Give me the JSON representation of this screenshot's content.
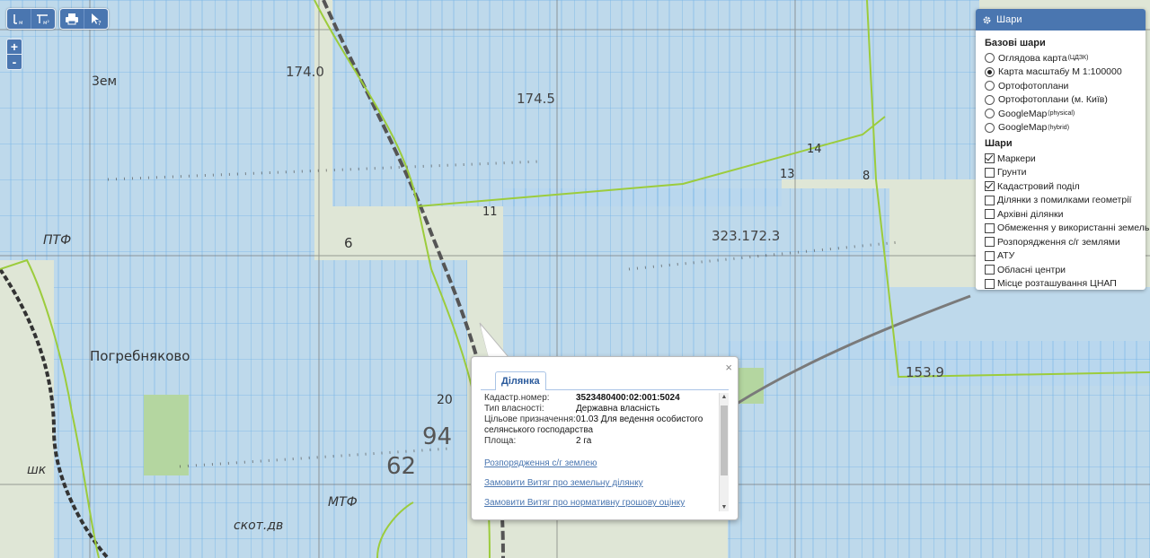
{
  "map": {
    "labels": [
      {
        "text": "174.0",
        "class": "elev"
      },
      {
        "text": "174.5",
        "class": "elev"
      },
      {
        "text": "3ем",
        "class": "place"
      },
      {
        "text": "ПТФ",
        "class": "place"
      },
      {
        "text": "6",
        "class": "elev"
      },
      {
        "text": "Погребняково",
        "class": "place"
      },
      {
        "text": "20",
        "class": "elev"
      },
      {
        "text": "94",
        "class": "big"
      },
      {
        "text": "62",
        "class": "big"
      },
      {
        "text": "МТФ",
        "class": "place"
      },
      {
        "text": "скот.дв",
        "class": "place"
      },
      {
        "text": "шк",
        "class": "place"
      },
      {
        "text": "323.172.3",
        "class": "elev"
      },
      {
        "text": "153.9",
        "class": "elev"
      },
      {
        "text": "13",
        "class": "elev"
      },
      {
        "text": "14",
        "class": "elev"
      },
      {
        "text": "8",
        "class": "elev"
      },
      {
        "text": "11",
        "class": "elev"
      }
    ]
  },
  "toolbar": {
    "buttons": [
      {
        "name": "measure-distance-button",
        "icon": "ruler-icon"
      },
      {
        "name": "measure-area-button",
        "icon": "area-measure-icon"
      },
      {
        "name": "print-button",
        "icon": "printer-icon"
      },
      {
        "name": "identify-button",
        "icon": "cursor-help-icon"
      }
    ]
  },
  "zoom": {
    "in": "+",
    "out": "-"
  },
  "layers": {
    "title": "Шари",
    "base_title": "Базові шари",
    "base": [
      {
        "label": "Оглядова карта",
        "sup": "(ЦДЗК)",
        "selected": false
      },
      {
        "label": "Карта масштабу М 1:100000",
        "sup": "",
        "selected": true
      },
      {
        "label": "Ортофотоплани",
        "sup": "",
        "selected": false
      },
      {
        "label": "Ортофотоплани (м. Київ)",
        "sup": "",
        "selected": false
      },
      {
        "label": "GoogleMap",
        "sup": "(physical)",
        "selected": false
      },
      {
        "label": "GoogleMap",
        "sup": "(hybrid)",
        "selected": false
      }
    ],
    "overlay_title": "Шари",
    "overlays": [
      {
        "label": "Маркери",
        "checked": true
      },
      {
        "label": "Грунти",
        "checked": false
      },
      {
        "label": "Кадастровий поділ",
        "checked": true
      },
      {
        "label": "Ділянки з помилками геометрії",
        "checked": false
      },
      {
        "label": "Архівні ділянки",
        "checked": false
      },
      {
        "label": "Обмеження у використанні земель",
        "checked": false
      },
      {
        "label": "Розпорядження с/г землями",
        "checked": false
      },
      {
        "label": "АТУ",
        "checked": false
      },
      {
        "label": "Обласні центри",
        "checked": false
      },
      {
        "label": "Місце розташування ЦНАП",
        "checked": false
      }
    ]
  },
  "popup": {
    "tab": "Ділянка",
    "close": "×",
    "rows": [
      {
        "k": "Кадастр.номер:",
        "v": "3523480400:02:001:5024",
        "bold": true
      },
      {
        "k": "Тип власності:",
        "v": "Державна власність",
        "bold": false
      },
      {
        "k": "Цільове призначення:",
        "v": "01.03 Для ведення особистого",
        "bold": false
      }
    ],
    "purpose_cont": "селянського господарства",
    "area_k": "Площа:",
    "area_v": "2 га",
    "links": [
      "Розпорядження с/г землею",
      "Замовити Витяг про земельну ділянку",
      "Замовити Витяг про нормативну грошову оцінку"
    ]
  },
  "colors": {
    "accent": "#4a76b0",
    "parcel_fill": "#b9d6ee",
    "parcel_stroke": "#6aaee6",
    "boundary": "#9ccc3c"
  }
}
